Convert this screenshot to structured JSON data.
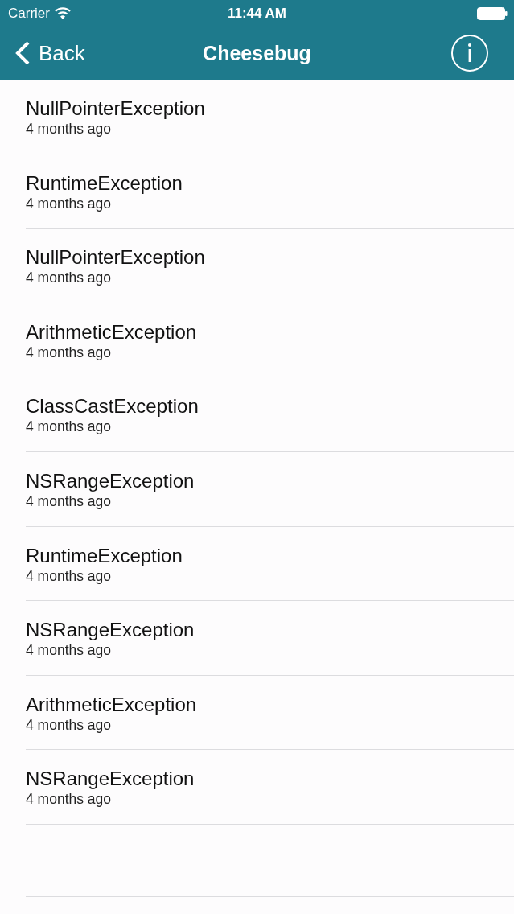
{
  "status_bar": {
    "carrier": "Carrier",
    "time": "11:44 AM"
  },
  "nav_bar": {
    "back": "Back",
    "title": "Cheesebug"
  },
  "rows": [
    {
      "title": "NullPointerException",
      "time": "4 months ago"
    },
    {
      "title": "RuntimeException",
      "time": "4 months ago"
    },
    {
      "title": "NullPointerException",
      "time": "4 months ago"
    },
    {
      "title": "ArithmeticException",
      "time": "4 months ago"
    },
    {
      "title": "ClassCastException",
      "time": "4 months ago"
    },
    {
      "title": "NSRangeException",
      "time": "4 months ago"
    },
    {
      "title": "RuntimeException",
      "time": "4 months ago"
    },
    {
      "title": "NSRangeException",
      "time": "4 months ago"
    },
    {
      "title": "ArithmeticException",
      "time": "4 months ago"
    },
    {
      "title": "NSRangeException",
      "time": "4 months ago"
    }
  ]
}
